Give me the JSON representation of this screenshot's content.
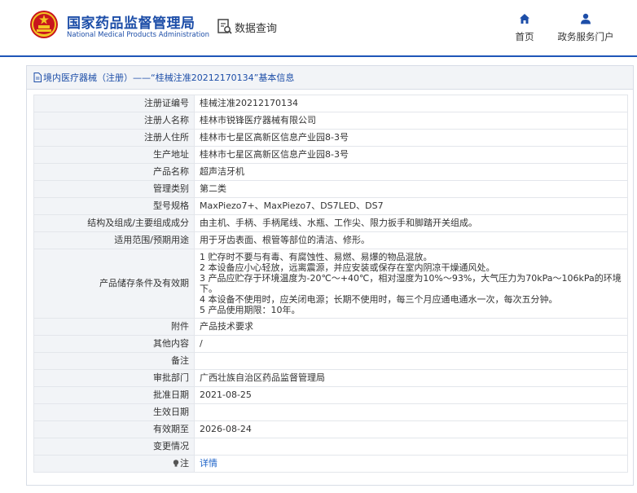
{
  "header": {
    "org_cn": "国家药品监督管理局",
    "org_en": "National Medical Products Administration",
    "query_label": "数据查询",
    "nav_home": "首页",
    "nav_service": "政务服务门户"
  },
  "panel": {
    "title": "境内医疗器械（注册）——“桂械注准20212170134”基本信息"
  },
  "rows": [
    {
      "label": "注册证编号",
      "value": "桂械注准20212170134"
    },
    {
      "label": "注册人名称",
      "value": "桂林市锐锋医疗器械有限公司"
    },
    {
      "label": "注册人住所",
      "value": "桂林市七星区高新区信息产业园8-3号"
    },
    {
      "label": "生产地址",
      "value": "桂林市七星区高新区信息产业园8-3号"
    },
    {
      "label": "产品名称",
      "value": "超声洁牙机"
    },
    {
      "label": "管理类别",
      "value": "第二类"
    },
    {
      "label": "型号规格",
      "value": "MaxPiezo7+、MaxPiezo7、DS7LED、DS7"
    },
    {
      "label": "结构及组成/主要组成成分",
      "value": "由主机、手柄、手柄尾线、水瓶、工作尖、限力扳手和脚踏开关组成。"
    },
    {
      "label": "适用范围/预期用途",
      "value": "用于牙齿表面、根管等部位的清洁、修形。"
    },
    {
      "label": "产品储存条件及有效期",
      "lines": [
        "1 贮存时不要与有毒、有腐蚀性、易燃、易爆的物品混放。",
        "2 本设备应小心轻放，远离震源，并应安装或保存在室内阴凉干燥通风处。",
        "3 产品应贮存于环境温度为-20℃～+40℃，相对湿度为10%～93%，大气压力为70kPa～106kPa的环境下。",
        "4 本设备不使用时，应关闭电源；长期不使用时，每三个月应通电通水一次，每次五分钟。",
        "5 产品使用期限：10年。"
      ]
    },
    {
      "label": "附件",
      "value": "产品技术要求"
    },
    {
      "label": "其他内容",
      "value": "/"
    },
    {
      "label": "备注",
      "value": ""
    },
    {
      "label": "审批部门",
      "value": "广西壮族自治区药品监督管理局"
    },
    {
      "label": "批准日期",
      "value": "2021-08-25"
    },
    {
      "label": "生效日期",
      "value": ""
    },
    {
      "label": "有效期至",
      "value": "2026-08-24"
    },
    {
      "label": "变更情况",
      "value": ""
    },
    {
      "label": "注",
      "value": "详情"
    }
  ],
  "colors": {
    "brand_blue": "#1d4ea8",
    "link_blue": "#1d63c8",
    "label_bg": "#f2f4f7",
    "border": "#e3e6eb",
    "emblem_red": "#c8161d",
    "emblem_gold": "#f3c623"
  },
  "icons": {
    "logo": "national-emblem-icon",
    "query": "document-search-icon",
    "home": "home-icon",
    "service": "user-icon",
    "title": "document-icon",
    "note": "lightbulb-icon"
  }
}
